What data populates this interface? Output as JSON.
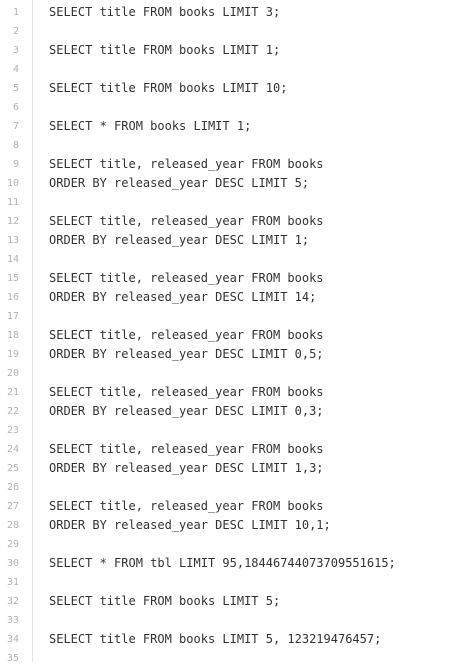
{
  "editor": {
    "lines": [
      {
        "number": "1",
        "text": "SELECT title FROM books LIMIT 3;"
      },
      {
        "number": "2",
        "text": ""
      },
      {
        "number": "3",
        "text": "SELECT title FROM books LIMIT 1;"
      },
      {
        "number": "4",
        "text": ""
      },
      {
        "number": "5",
        "text": "SELECT title FROM books LIMIT 10;"
      },
      {
        "number": "6",
        "text": ""
      },
      {
        "number": "7",
        "text": "SELECT * FROM books LIMIT 1;"
      },
      {
        "number": "8",
        "text": ""
      },
      {
        "number": "9",
        "text": "SELECT title, released_year FROM books"
      },
      {
        "number": "10",
        "text": "ORDER BY released_year DESC LIMIT 5;"
      },
      {
        "number": "11",
        "text": ""
      },
      {
        "number": "12",
        "text": "SELECT title, released_year FROM books"
      },
      {
        "number": "13",
        "text": "ORDER BY released_year DESC LIMIT 1;"
      },
      {
        "number": "14",
        "text": ""
      },
      {
        "number": "15",
        "text": "SELECT title, released_year FROM books"
      },
      {
        "number": "16",
        "text": "ORDER BY released_year DESC LIMIT 14;"
      },
      {
        "number": "17",
        "text": ""
      },
      {
        "number": "18",
        "text": "SELECT title, released_year FROM books"
      },
      {
        "number": "19",
        "text": "ORDER BY released_year DESC LIMIT 0,5;"
      },
      {
        "number": "20",
        "text": ""
      },
      {
        "number": "21",
        "text": "SELECT title, released_year FROM books"
      },
      {
        "number": "22",
        "text": "ORDER BY released_year DESC LIMIT 0,3;"
      },
      {
        "number": "23",
        "text": ""
      },
      {
        "number": "24",
        "text": "SELECT title, released_year FROM books"
      },
      {
        "number": "25",
        "text": "ORDER BY released_year DESC LIMIT 1,3;"
      },
      {
        "number": "26",
        "text": ""
      },
      {
        "number": "27",
        "text": "SELECT title, released_year FROM books"
      },
      {
        "number": "28",
        "text": "ORDER BY released_year DESC LIMIT 10,1;"
      },
      {
        "number": "29",
        "text": ""
      },
      {
        "number": "30",
        "text": "SELECT * FROM tbl LIMIT 95,18446744073709551615;"
      },
      {
        "number": "31",
        "text": ""
      },
      {
        "number": "32",
        "text": "SELECT title FROM books LIMIT 5;"
      },
      {
        "number": "33",
        "text": ""
      },
      {
        "number": "34",
        "text": "SELECT title FROM books LIMIT 5, 123219476457;"
      },
      {
        "number": "35",
        "text": ""
      }
    ]
  }
}
